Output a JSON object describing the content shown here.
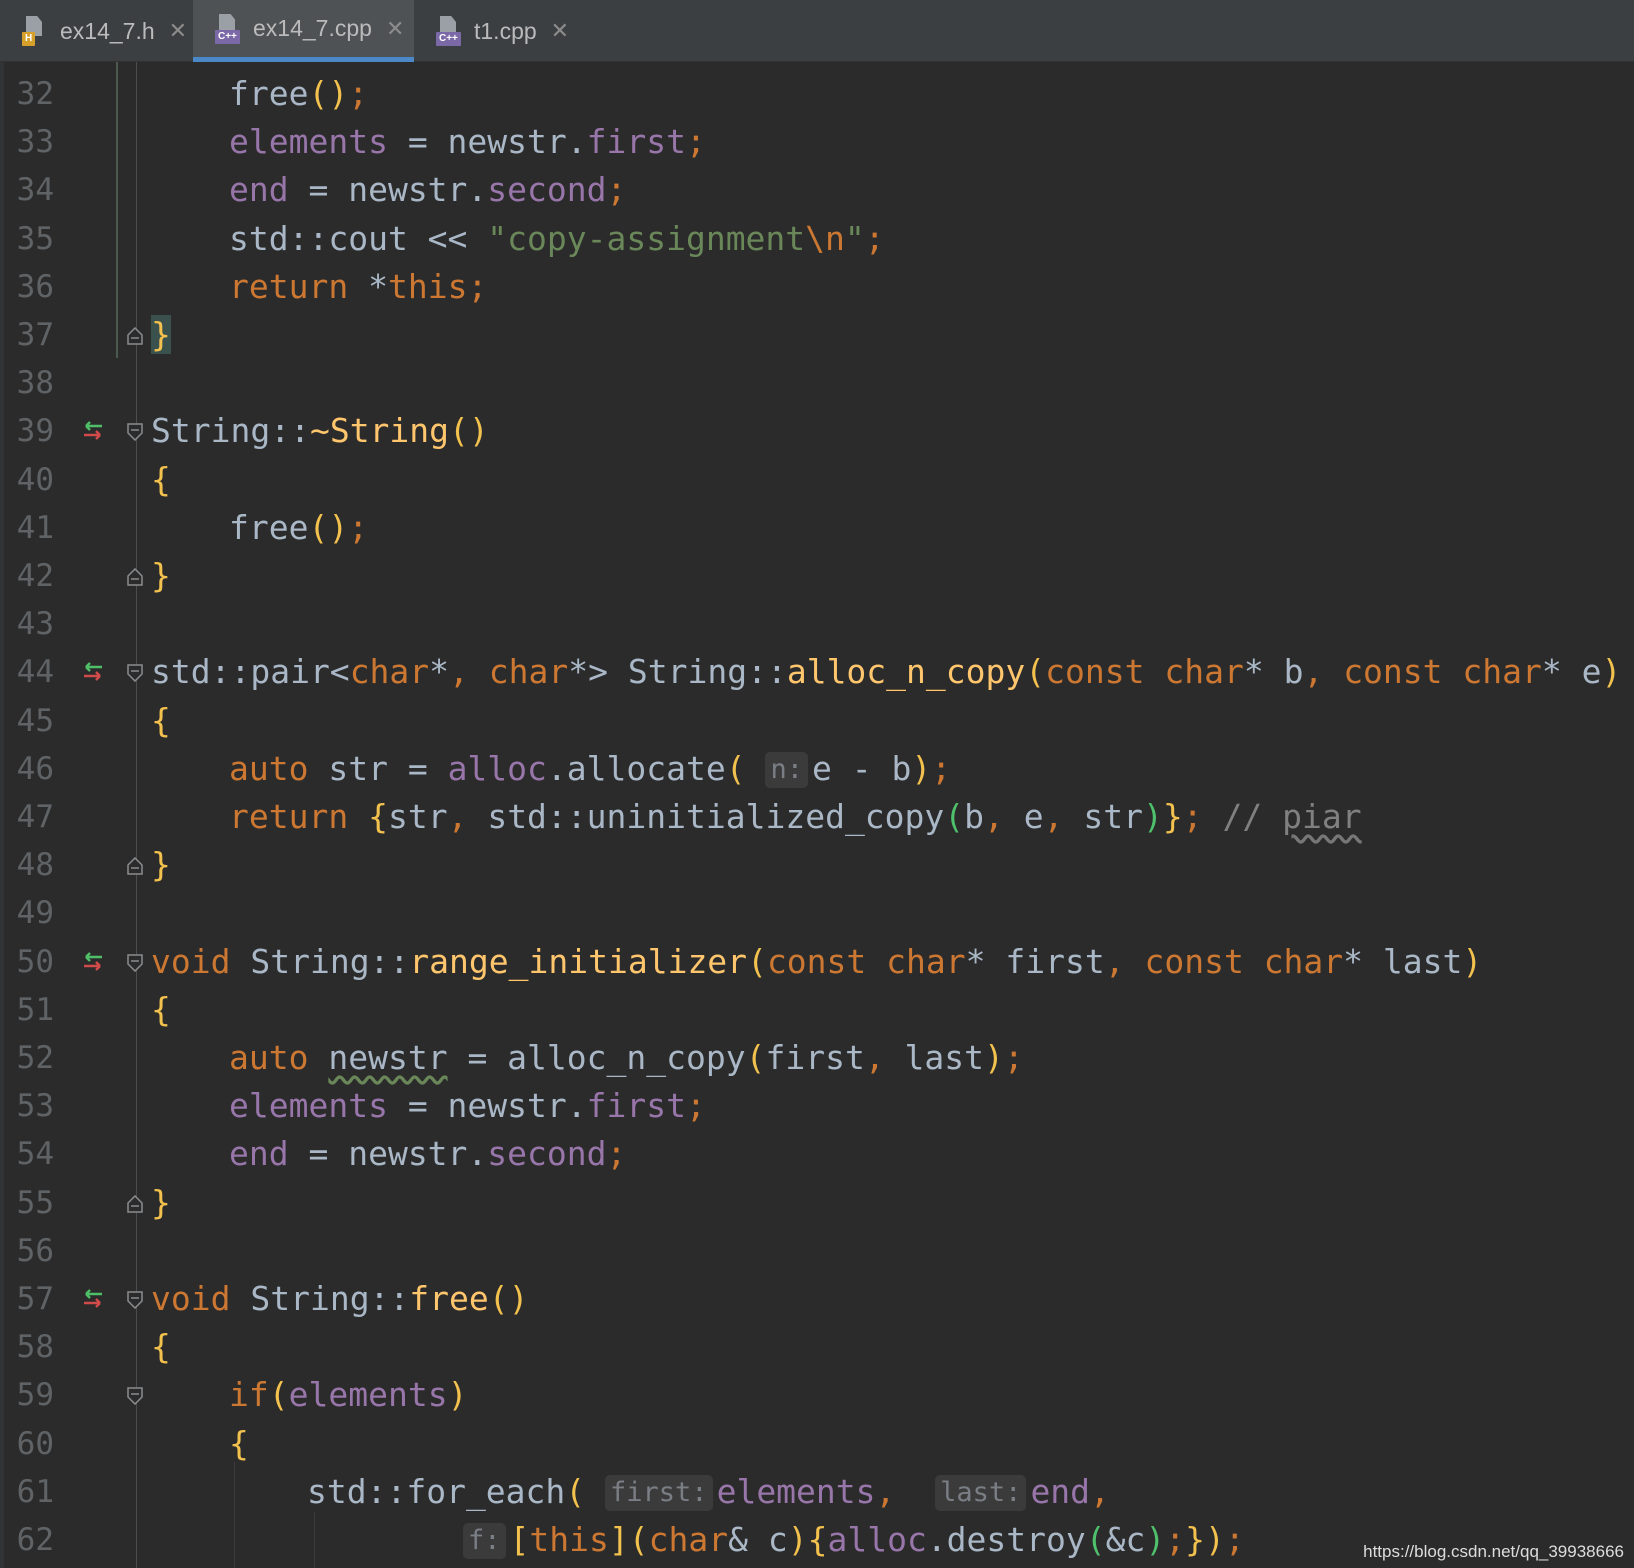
{
  "tabs": [
    {
      "label": "ex14_7.h",
      "badge": "H",
      "badge_color": "#d6a02a",
      "active": false
    },
    {
      "label": "ex14_7.cpp",
      "badge": "C++",
      "badge_color": "#7b68a6",
      "active": true
    },
    {
      "label": "t1.cpp",
      "badge": "C++",
      "badge_color": "#7b68a6",
      "active": false
    }
  ],
  "close_glyph": "✕",
  "lines": [
    {
      "n": "32",
      "code": "free();"
    },
    {
      "n": "33",
      "code": "elements = newstr.first;"
    },
    {
      "n": "34",
      "code": "end = newstr.second;"
    },
    {
      "n": "35",
      "code": "std::cout << \"copy-assignment\\n\";"
    },
    {
      "n": "36",
      "code": "return *this;"
    },
    {
      "n": "37",
      "code": "}"
    },
    {
      "n": "38",
      "code": ""
    },
    {
      "n": "39",
      "code": "String::~String()"
    },
    {
      "n": "40",
      "code": "{"
    },
    {
      "n": "41",
      "code": "free();"
    },
    {
      "n": "42",
      "code": "}"
    },
    {
      "n": "43",
      "code": ""
    },
    {
      "n": "44",
      "code": "std::pair<char*, char*> String::alloc_n_copy(const char* b, const char* e)"
    },
    {
      "n": "45",
      "code": "{"
    },
    {
      "n": "46",
      "code": "auto str = alloc.allocate( n: e - b);"
    },
    {
      "n": "47",
      "code": "return {str, std::uninitialized_copy(b, e, str)}; // piar"
    },
    {
      "n": "48",
      "code": "}"
    },
    {
      "n": "49",
      "code": ""
    },
    {
      "n": "50",
      "code": "void String::range_initializer(const char* first, const char* last)"
    },
    {
      "n": "51",
      "code": "{"
    },
    {
      "n": "52",
      "code": "auto newstr = alloc_n_copy(first, last);"
    },
    {
      "n": "53",
      "code": "elements = newstr.first;"
    },
    {
      "n": "54",
      "code": "end = newstr.second;"
    },
    {
      "n": "55",
      "code": "}"
    },
    {
      "n": "56",
      "code": ""
    },
    {
      "n": "57",
      "code": "void String::free()"
    },
    {
      "n": "58",
      "code": "{"
    },
    {
      "n": "59",
      "code": "if(elements)"
    },
    {
      "n": "60",
      "code": "{"
    },
    {
      "n": "61",
      "code": "std::for_each( first: elements,  last: end,"
    },
    {
      "n": "62",
      "code": "f: [this](char& c){alloc.destroy(&c);});"
    }
  ],
  "override_marker_lines": [
    "39",
    "44",
    "50",
    "57"
  ],
  "fold_marker_lines": [
    "37",
    "39",
    "42",
    "44",
    "48",
    "50",
    "55",
    "57",
    "59"
  ],
  "watermark": "https://blog.csdn.net/qq_39938666",
  "colors": {
    "background": "#2b2b2b",
    "keyword": "#cc7832",
    "function": "#ffc66d",
    "member": "#9876aa",
    "string": "#6a8759",
    "comment": "#808080",
    "default": "#a9b7c6",
    "active_tab_underline": "#4a88c7"
  }
}
